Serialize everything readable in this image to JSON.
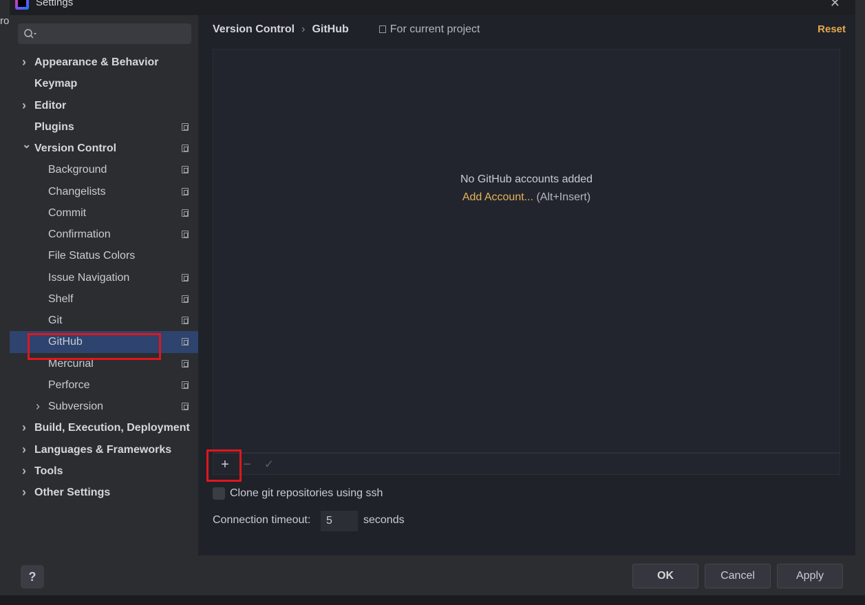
{
  "window": {
    "title": "Settings",
    "background_partial_text": "ro"
  },
  "search": {
    "placeholder": ""
  },
  "sidebar": {
    "items": [
      {
        "label": "Appearance & Behavior",
        "level": 0,
        "expandable": true,
        "expanded": false,
        "bold": true,
        "project_icon": false
      },
      {
        "label": "Keymap",
        "level": 0,
        "expandable": false,
        "bold": true,
        "project_icon": false
      },
      {
        "label": "Editor",
        "level": 0,
        "expandable": true,
        "expanded": false,
        "bold": true,
        "project_icon": false
      },
      {
        "label": "Plugins",
        "level": 0,
        "expandable": false,
        "bold": true,
        "project_icon": true
      },
      {
        "label": "Version Control",
        "level": 0,
        "expandable": true,
        "expanded": true,
        "bold": true,
        "project_icon": true
      },
      {
        "label": "Background",
        "level": 1,
        "expandable": false,
        "bold": false,
        "project_icon": true
      },
      {
        "label": "Changelists",
        "level": 1,
        "expandable": false,
        "bold": false,
        "project_icon": true
      },
      {
        "label": "Commit",
        "level": 1,
        "expandable": false,
        "bold": false,
        "project_icon": true
      },
      {
        "label": "Confirmation",
        "level": 1,
        "expandable": false,
        "bold": false,
        "project_icon": true
      },
      {
        "label": "File Status Colors",
        "level": 1,
        "expandable": false,
        "bold": false,
        "project_icon": false
      },
      {
        "label": "Issue Navigation",
        "level": 1,
        "expandable": false,
        "bold": false,
        "project_icon": true
      },
      {
        "label": "Shelf",
        "level": 1,
        "expandable": false,
        "bold": false,
        "project_icon": true
      },
      {
        "label": "Git",
        "level": 1,
        "expandable": false,
        "bold": false,
        "project_icon": true
      },
      {
        "label": "GitHub",
        "level": 1,
        "expandable": false,
        "bold": false,
        "project_icon": true,
        "selected": true
      },
      {
        "label": "Mercurial",
        "level": 1,
        "expandable": false,
        "bold": false,
        "project_icon": true
      },
      {
        "label": "Perforce",
        "level": 1,
        "expandable": false,
        "bold": false,
        "project_icon": true
      },
      {
        "label": "Subversion",
        "level": 1,
        "expandable": true,
        "expanded": false,
        "bold": false,
        "project_icon": true
      },
      {
        "label": "Build, Execution, Deployment",
        "level": 0,
        "expandable": true,
        "expanded": false,
        "bold": true,
        "project_icon": false
      },
      {
        "label": "Languages & Frameworks",
        "level": 0,
        "expandable": true,
        "expanded": false,
        "bold": true,
        "project_icon": false
      },
      {
        "label": "Tools",
        "level": 0,
        "expandable": true,
        "expanded": false,
        "bold": true,
        "project_icon": false
      },
      {
        "label": "Other Settings",
        "level": 0,
        "expandable": true,
        "expanded": false,
        "bold": true,
        "project_icon": false
      }
    ]
  },
  "breadcrumb": {
    "parts": [
      "Version Control",
      "GitHub"
    ],
    "separator": "›",
    "scope": "For current project"
  },
  "reset_label": "Reset",
  "accounts": {
    "empty_message": "No GitHub accounts added",
    "add_link": "Add Account...",
    "add_hint": " (Alt+Insert)"
  },
  "toolbar": {
    "add_symbol": "+",
    "remove_symbol": "−",
    "default_symbol": "✓"
  },
  "clone_ssh": {
    "label": "Clone git repositories using ssh",
    "checked": false
  },
  "timeout": {
    "label": "Connection timeout:",
    "value": "5",
    "unit": "seconds"
  },
  "footer": {
    "help_label": "?",
    "ok_label": "OK",
    "cancel_label": "Cancel",
    "apply_label": "Apply"
  },
  "colors": {
    "accent_link": "#e6b35a",
    "reset": "#e6a94e",
    "selection": "#2e436e",
    "highlight_box": "#e0161d"
  }
}
